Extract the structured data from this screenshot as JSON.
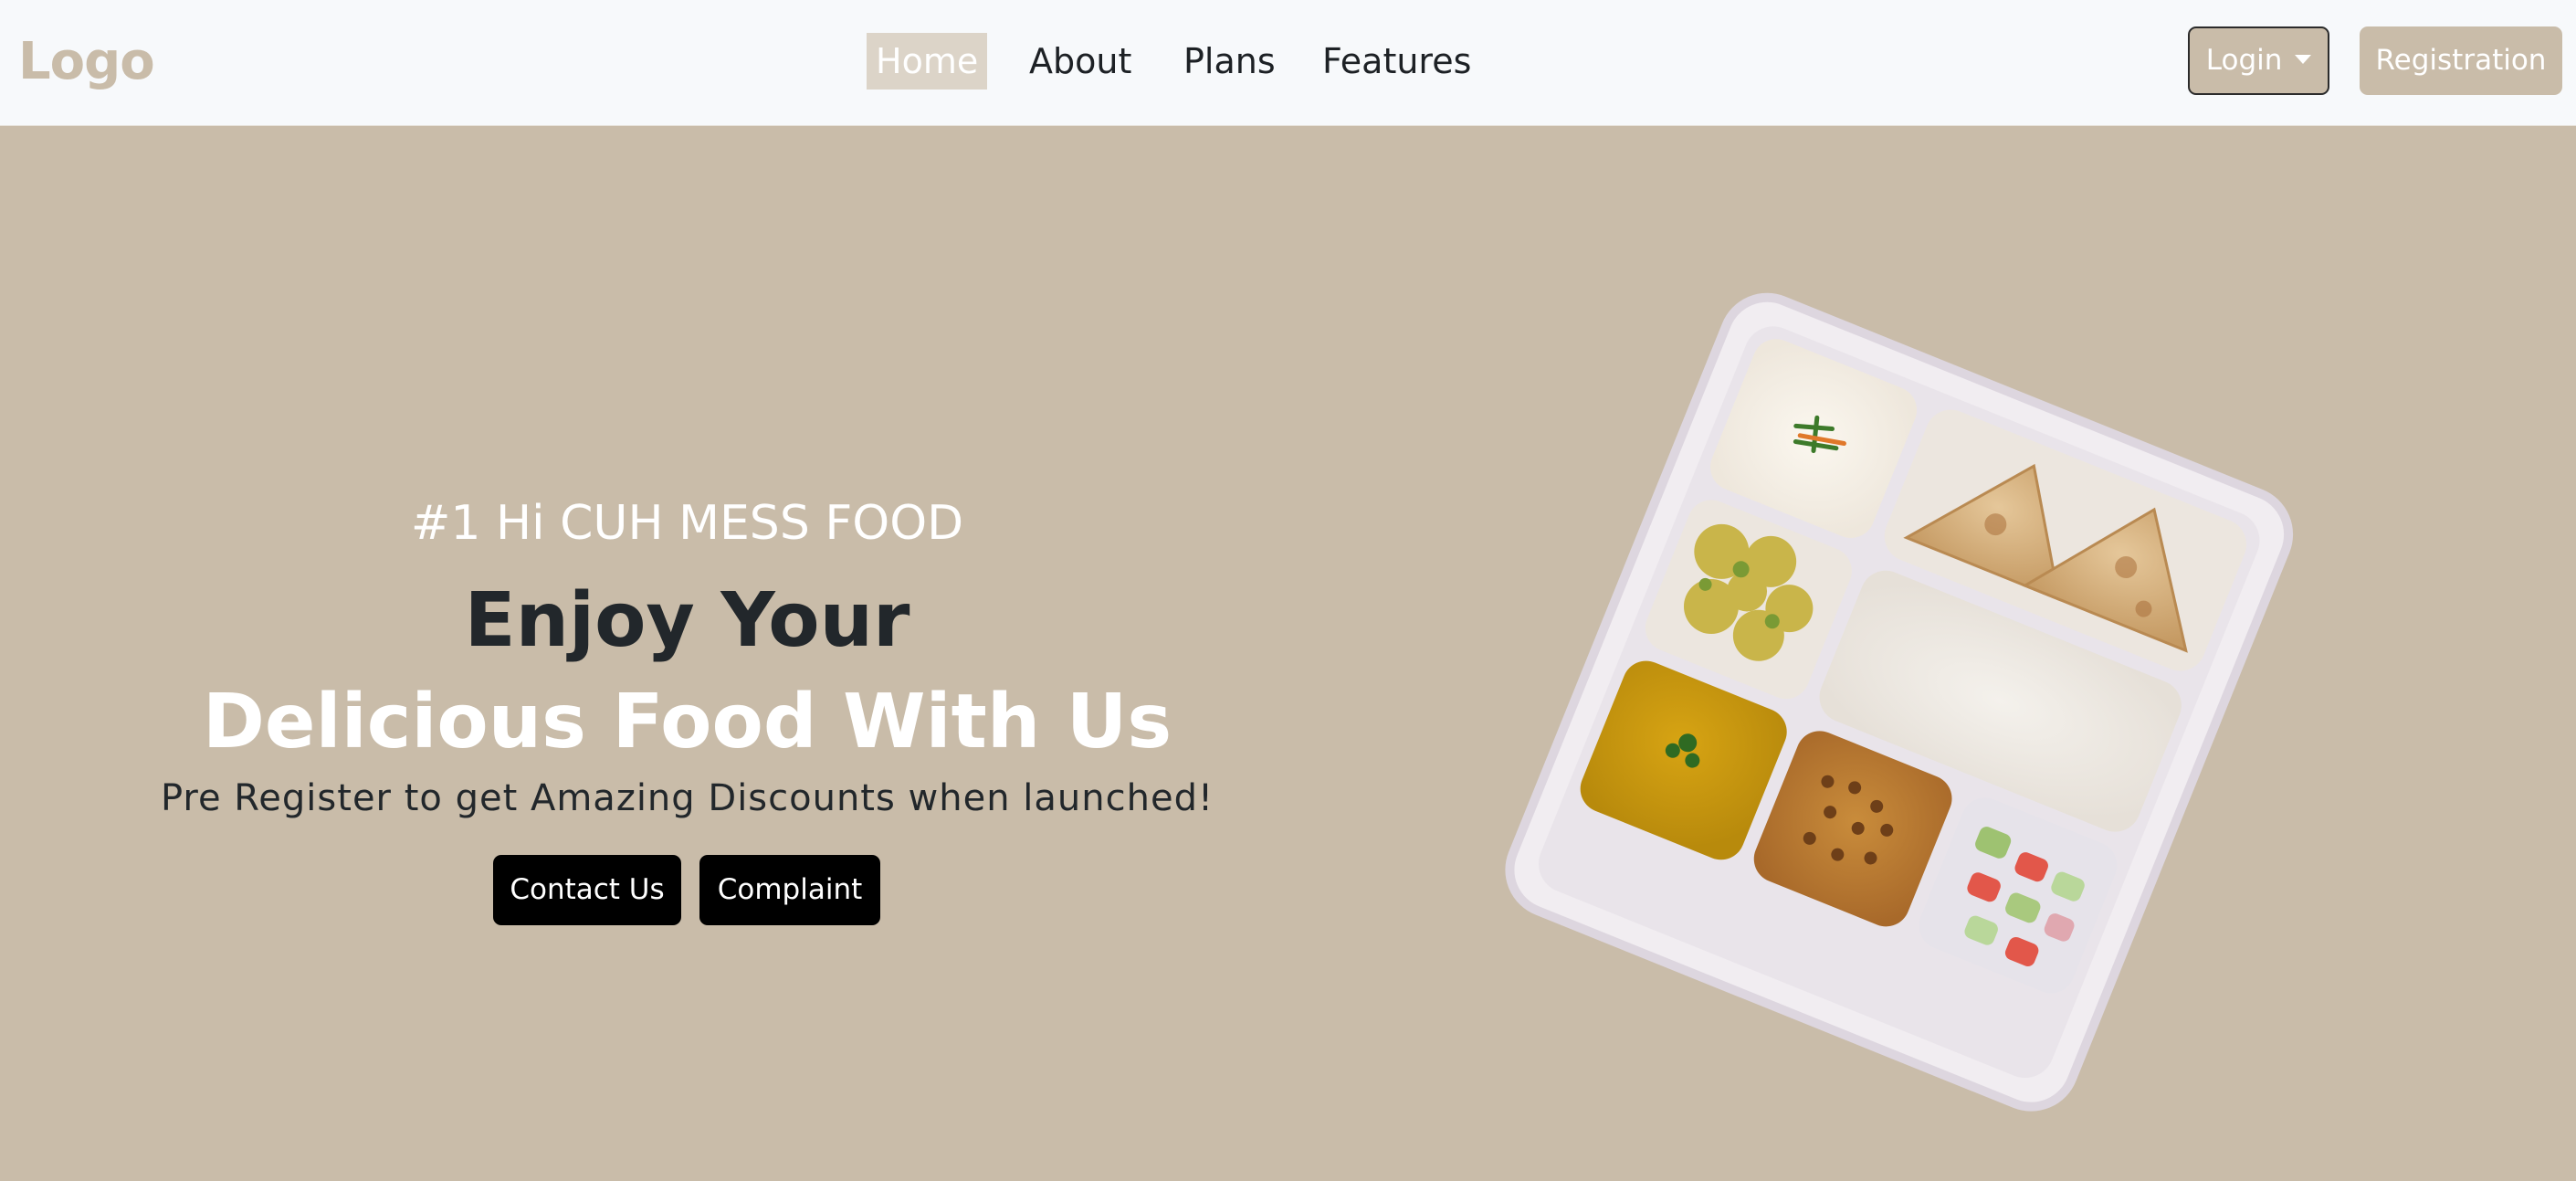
{
  "nav": {
    "logo": "Logo",
    "links": [
      {
        "label": "Home",
        "active": true
      },
      {
        "label": "About",
        "active": false
      },
      {
        "label": "Plans",
        "active": false
      },
      {
        "label": "Features",
        "active": false
      }
    ],
    "login_label": "Login",
    "register_label": "Registration"
  },
  "hero": {
    "eyebrow": "#1 Hi CUH MESS FOOD",
    "title_line1": "Enjoy Your",
    "title_line2": "Delicious Food With Us",
    "subtitle": "Pre Register to get Amazing Discounts when launched!",
    "contact_label": "Contact Us",
    "complaint_label": "Complaint"
  },
  "colors": {
    "accent": "#c9bca9",
    "nav_bg": "#f7f9fb",
    "dark_text": "#22272b",
    "button_dark": "#000000",
    "active_tab_bg": "#dcd4c8"
  },
  "icons": {
    "login_caret": "caret-down-icon"
  }
}
